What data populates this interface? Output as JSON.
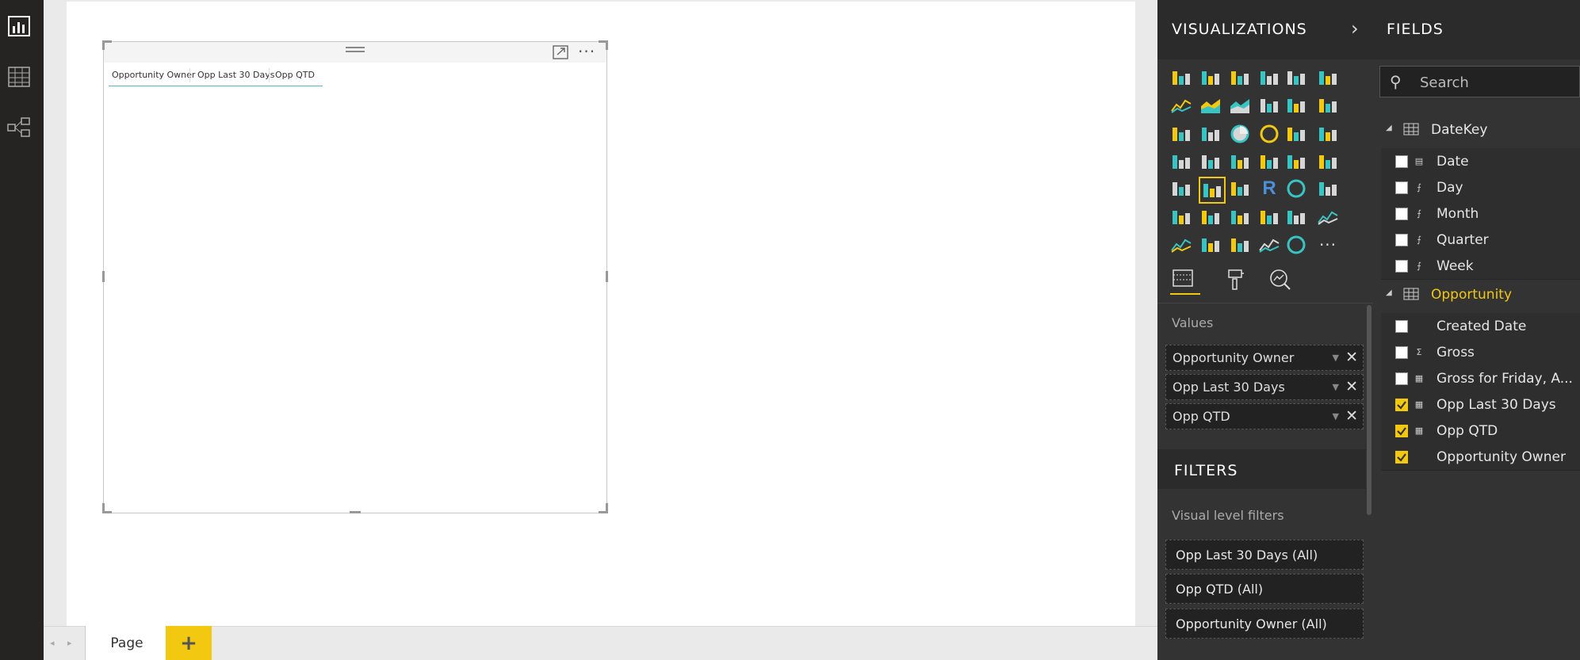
{
  "canvas": {
    "visual": {
      "columns": [
        "Opportunity Owner",
        "Opp Last 30 Days",
        "Opp QTD"
      ]
    }
  },
  "page_tabs": {
    "page_label": "Page",
    "add_label": "+"
  },
  "visualizations": {
    "title": "VISUALIZATIONS",
    "expand_icon": "chevron-right-icon",
    "values_label": "Values",
    "values": [
      "Opportunity Owner",
      "Opp Last 30 Days",
      "Opp QTD"
    ]
  },
  "filters": {
    "title": "FILTERS",
    "visual_level_label": "Visual level filters",
    "items": [
      "Opp Last 30 Days  (All)",
      "Opp QTD  (All)",
      "Opportunity Owner  (All)"
    ]
  },
  "fields": {
    "title": "FIELDS",
    "search_placeholder": "Search",
    "tables": [
      {
        "name": "DateKey",
        "fields": [
          {
            "label": "Date",
            "type": "date",
            "checked": false
          },
          {
            "label": "Day",
            "type": "calc",
            "checked": false
          },
          {
            "label": "Month",
            "type": "calc",
            "checked": false
          },
          {
            "label": "Quarter",
            "type": "calc",
            "checked": false
          },
          {
            "label": "Week",
            "type": "calc",
            "checked": false
          }
        ]
      },
      {
        "name": "Opportunity",
        "fields": [
          {
            "label": "Created Date",
            "type": "none",
            "checked": false
          },
          {
            "label": "Gross",
            "type": "sigma",
            "checked": false
          },
          {
            "label": "Gross for Friday, A...",
            "type": "measure",
            "checked": false
          },
          {
            "label": "Opp Last 30 Days",
            "type": "measure",
            "checked": true
          },
          {
            "label": "Opp QTD",
            "type": "measure",
            "checked": true
          },
          {
            "label": "Opportunity Owner",
            "type": "none",
            "checked": true
          }
        ]
      }
    ]
  },
  "colors": {
    "accent": "#F2C811",
    "pane_bg": "#333333",
    "nav_bg": "#252423",
    "table_underline": "#4FC1C1"
  }
}
